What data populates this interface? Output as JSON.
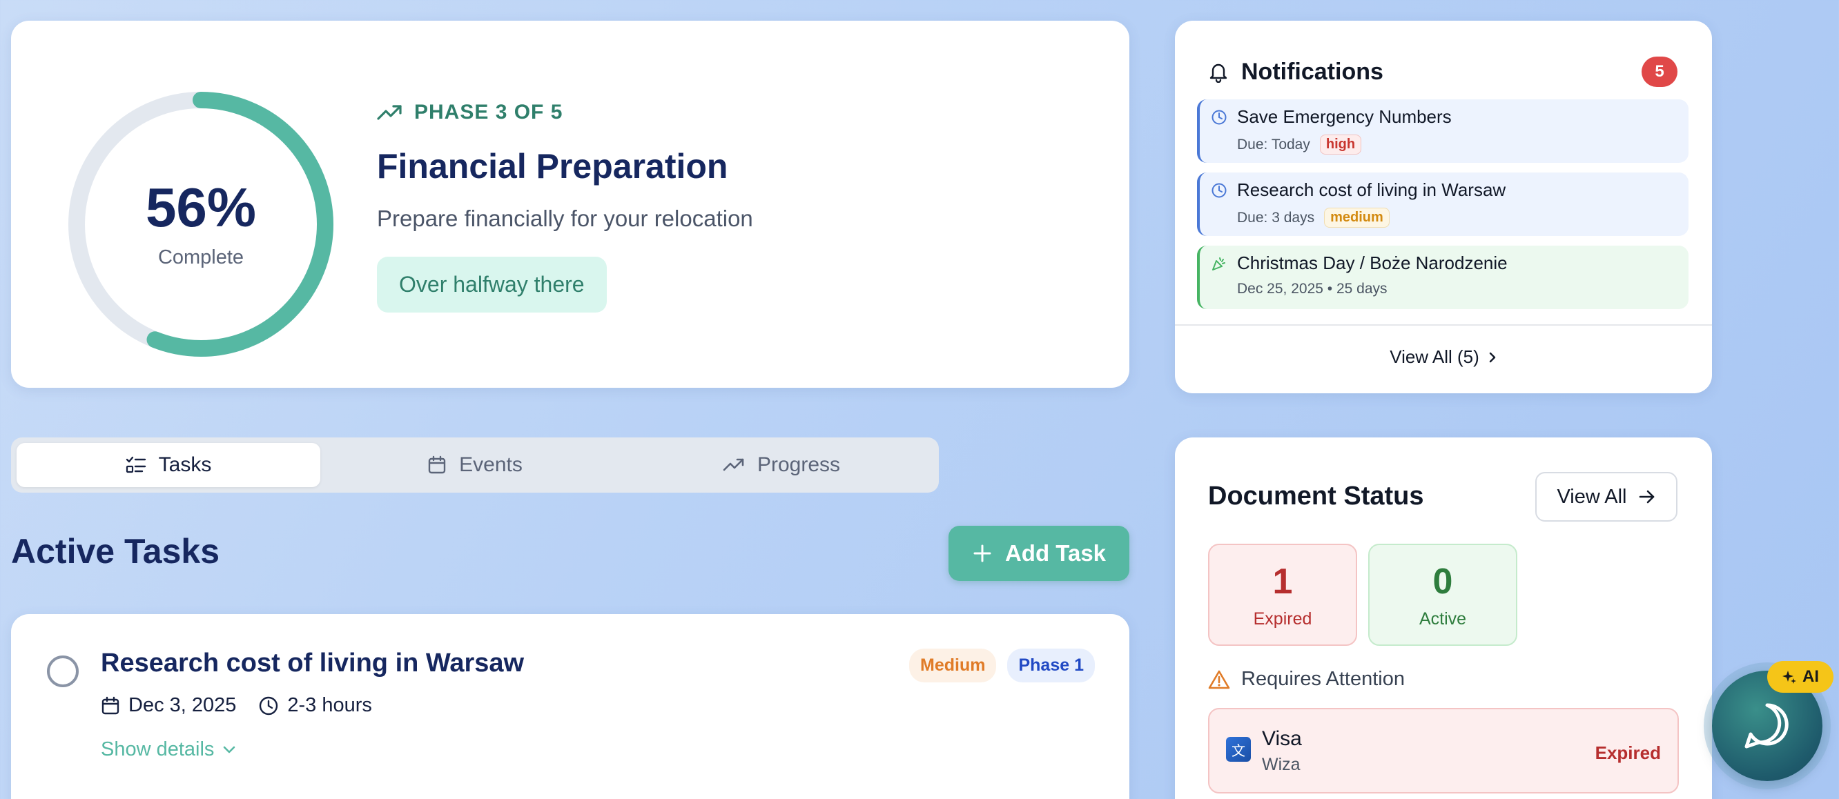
{
  "phase": {
    "progress_percent": 56,
    "percent_label": "56%",
    "complete_label": "Complete",
    "eyebrow": "PHASE 3 OF 5",
    "title": "Financial Preparation",
    "subtitle": "Prepare financially for your relocation",
    "badge": "Over halfway there",
    "colors": {
      "ring": "#56b8a3",
      "track": "#e3e8ef"
    }
  },
  "tabs": [
    {
      "label": "Tasks",
      "icon": "list-check-icon",
      "active": true
    },
    {
      "label": "Events",
      "icon": "calendar-icon",
      "active": false
    },
    {
      "label": "Progress",
      "icon": "trending-up-icon",
      "active": false
    }
  ],
  "tasks": {
    "heading": "Active Tasks",
    "add_label": "Add Task",
    "items": [
      {
        "title": "Research cost of living in Warsaw",
        "date": "Dec 3, 2025",
        "duration": "2-3 hours",
        "details_label": "Show details",
        "priority": "Medium",
        "phase": "Phase 1"
      }
    ]
  },
  "notifications": {
    "title": "Notifications",
    "count": "5",
    "items": [
      {
        "title": "Save Emergency Numbers",
        "sub": "Due: Today",
        "priority": "high",
        "icon": "clock-icon"
      },
      {
        "title": "Research cost of living in Warsaw",
        "sub": "Due: 3 days",
        "priority": "medium",
        "icon": "clock-icon"
      },
      {
        "title": "Christmas Day / Boże Narodzenie",
        "sub": "Dec 25, 2025 • 25 days",
        "icon": "party-popper-icon"
      }
    ],
    "view_all": "View All (5)"
  },
  "documents": {
    "title": "Document Status",
    "view_all": "View All",
    "stats": {
      "expired": {
        "value": "1",
        "label": "Expired"
      },
      "active": {
        "value": "0",
        "label": "Active"
      }
    },
    "attention_label": "Requires Attention",
    "items": [
      {
        "name": "Visa",
        "sub": "Wiza",
        "status": "Expired"
      }
    ]
  },
  "ai": {
    "badge": "AI"
  }
}
